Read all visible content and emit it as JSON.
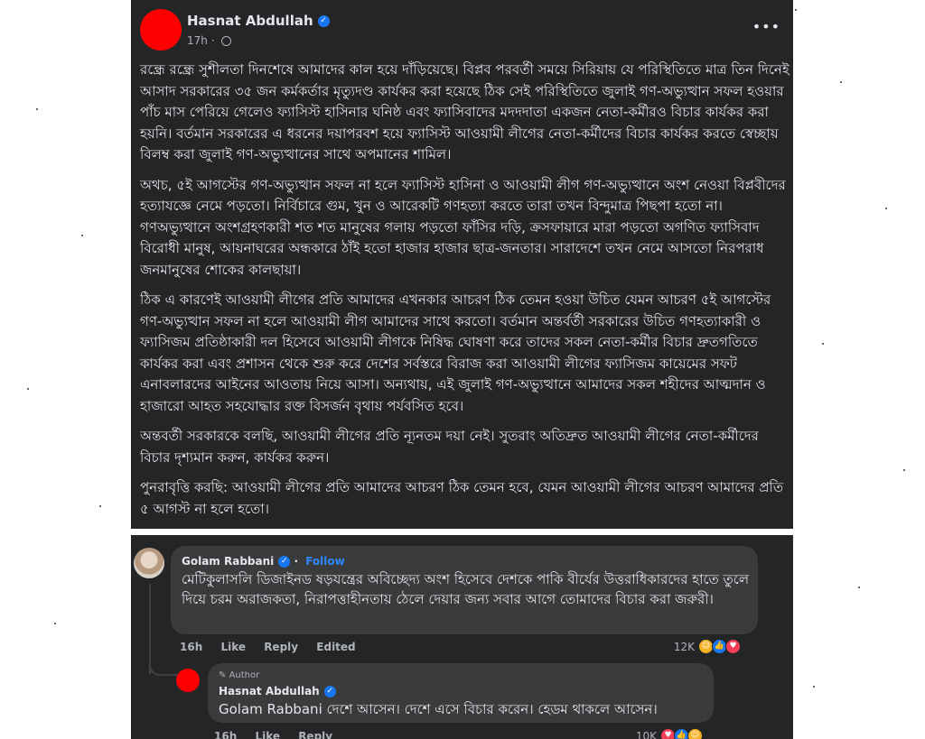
{
  "post": {
    "author": "Hasnat Abdullah",
    "time": "17h",
    "more_label": "•••",
    "paragraphs": [
      "রন্ধ্রে রন্ধ্রে সুশীলতা দিনশেষে আমাদের কাল হয়ে দাঁড়িয়েছে। বিপ্লব পরবর্তী সময়ে সিরিয়ায় যে পরিস্থিতিতে মাত্র তিন দিনেই আসাদ সরকারের ৩৫ জন কর্মকর্তার মৃত্যুদণ্ড কার্যকর করা হয়েছে ঠিক সেই পরিস্থিতিতে জুলাই গণ-অভ্যুত্থান সফল হওয়ার পাঁচ মাস পেরিয়ে গেলেও ফ্যাসিস্ট হাসিনার ঘনিষ্ঠ এবং ফ্যাসিবাদের মদদদাতা একজন নেতা-কর্মীরও বিচার কার্যকর করা হয়নি। বর্তমান সরকারের এ ধরনের দয়াপরবশ হয়ে ফ্যাসিস্ট আওয়ামী লীগের নেতা-কর্মীদের বিচার কার্যকর করতে স্বেচ্ছায় বিলম্ব করা জুলাই গণ-অভ্যুত্থানের সাথে অপমানের শামিল।",
      "অথচ, ৫ই আগস্টের গণ-অভ্যুত্থান সফল না হলে ফ্যাসিস্ট হাসিনা ও আওয়ামী লীগ গণ-অভ্যুত্থানে অংশ নেওয়া বিপ্লবীদের হত্যাযজ্ঞে নেমে পড়তো। নির্বিচারে গুম, খুন ও আরেকটি গণহত্যা করতে তারা তখন বিন্দুমাত্র পিছপা হতো না। গণঅভ্যুত্থানে অংশগ্রহণকারী শত শত মানুষের গলায় পড়তো ফাঁসির দড়ি, ক্রসফায়ারে মারা পড়তো অগণিত ফ্যাসিবাদ বিরোধী মানুষ, আয়নাঘরের অন্ধকারে ঠাঁই হতো হাজার হাজার ছাত্র-জনতার। সারাদেশে তখন নেমে আসতো নিরপরাধ জনমানুষের শোকের কালছায়া।",
      "ঠিক এ কারণেই আওয়ামী লীগের প্রতি আমাদের এখনকার আচরণ ঠিক তেমন হওয়া উচিত যেমন আচরণ ৫ই আগস্টের গণ-অভ্যুত্থান সফল না হলে আওয়ামী লীগ আমাদের সাথে করতো। বর্তমান অন্তর্বর্তী সরকারের উচিত গণহত্যাকারী ও ফ্যাসিজম প্রতিষ্ঠাকারী দল হিসেবে আওয়ামী লীগকে নিষিদ্ধ ঘোষণা করে তাদের সকল নেতা-কর্মীর বিচার দ্রুতগতিতে কার্যকর করা এবং প্রশাসন থেকে শুরু করে দেশের সর্বস্তরে বিরাজ করা আওয়ামী লীগের ফ্যাসিজম কায়েমের সফট এনাবলারদের আইনের আওতায় নিয়ে আসা। অন্যথায়, এই জুলাই গণ-অভ্যুত্থানে আমাদের সকল শহীদের আত্মদান ও হাজারো আহত সহযোদ্ধার রক্ত বিসর্জন বৃথায় পর্যবসিত হবে।",
      "অন্তবর্তী সরকারকে বলছি, আওয়ামী লীগের প্রতি ন্যূনতম দয়া নেই। সুতরাং অতিদ্রুত আওয়ামী লীগের নেতা-কর্মীদের বিচার দৃশ্যমান করুন, কার্যকর করুন।",
      "পুনরাবৃত্তি করছি: আওয়ামী লীগের প্রতি আমাদের আচরণ ঠিক তেমন হবে, যেমন আওয়ামী লীগের আচরণ আমাদের প্রতি ৫ আগস্ট না হলে হতো।"
    ]
  },
  "comment": {
    "author": "Golam Rabbani",
    "follow_label": "Follow",
    "text": "মেটিকুলাসলি ডিজাইনড ষড়যন্ত্রের অবিচ্ছেদ্য অংশ হিসেবে দেশকে পাকি বীর্যের উত্তরাধিকারদের হাতে তুলে দিয়ে চরম অরাজকতা, নিরাপত্তাহীনতায় ঠেলে দেয়ার জন্য সবার আগে তোমাদের বিচার করা জরুরী।",
    "time": "16h",
    "like_label": "Like",
    "reply_label": "Reply",
    "edited_label": "Edited",
    "reactions_count": "12K"
  },
  "reply": {
    "badge": "Author",
    "author": "Hasnat Abdullah",
    "text": "Golam Rabbani দেশে আসেন। দেশে এসে বিচার করেন। হেডম থাকলে আসেন।",
    "time": "16h",
    "like_label": "Like",
    "reply_label": "Reply",
    "reactions_count": "10K"
  }
}
